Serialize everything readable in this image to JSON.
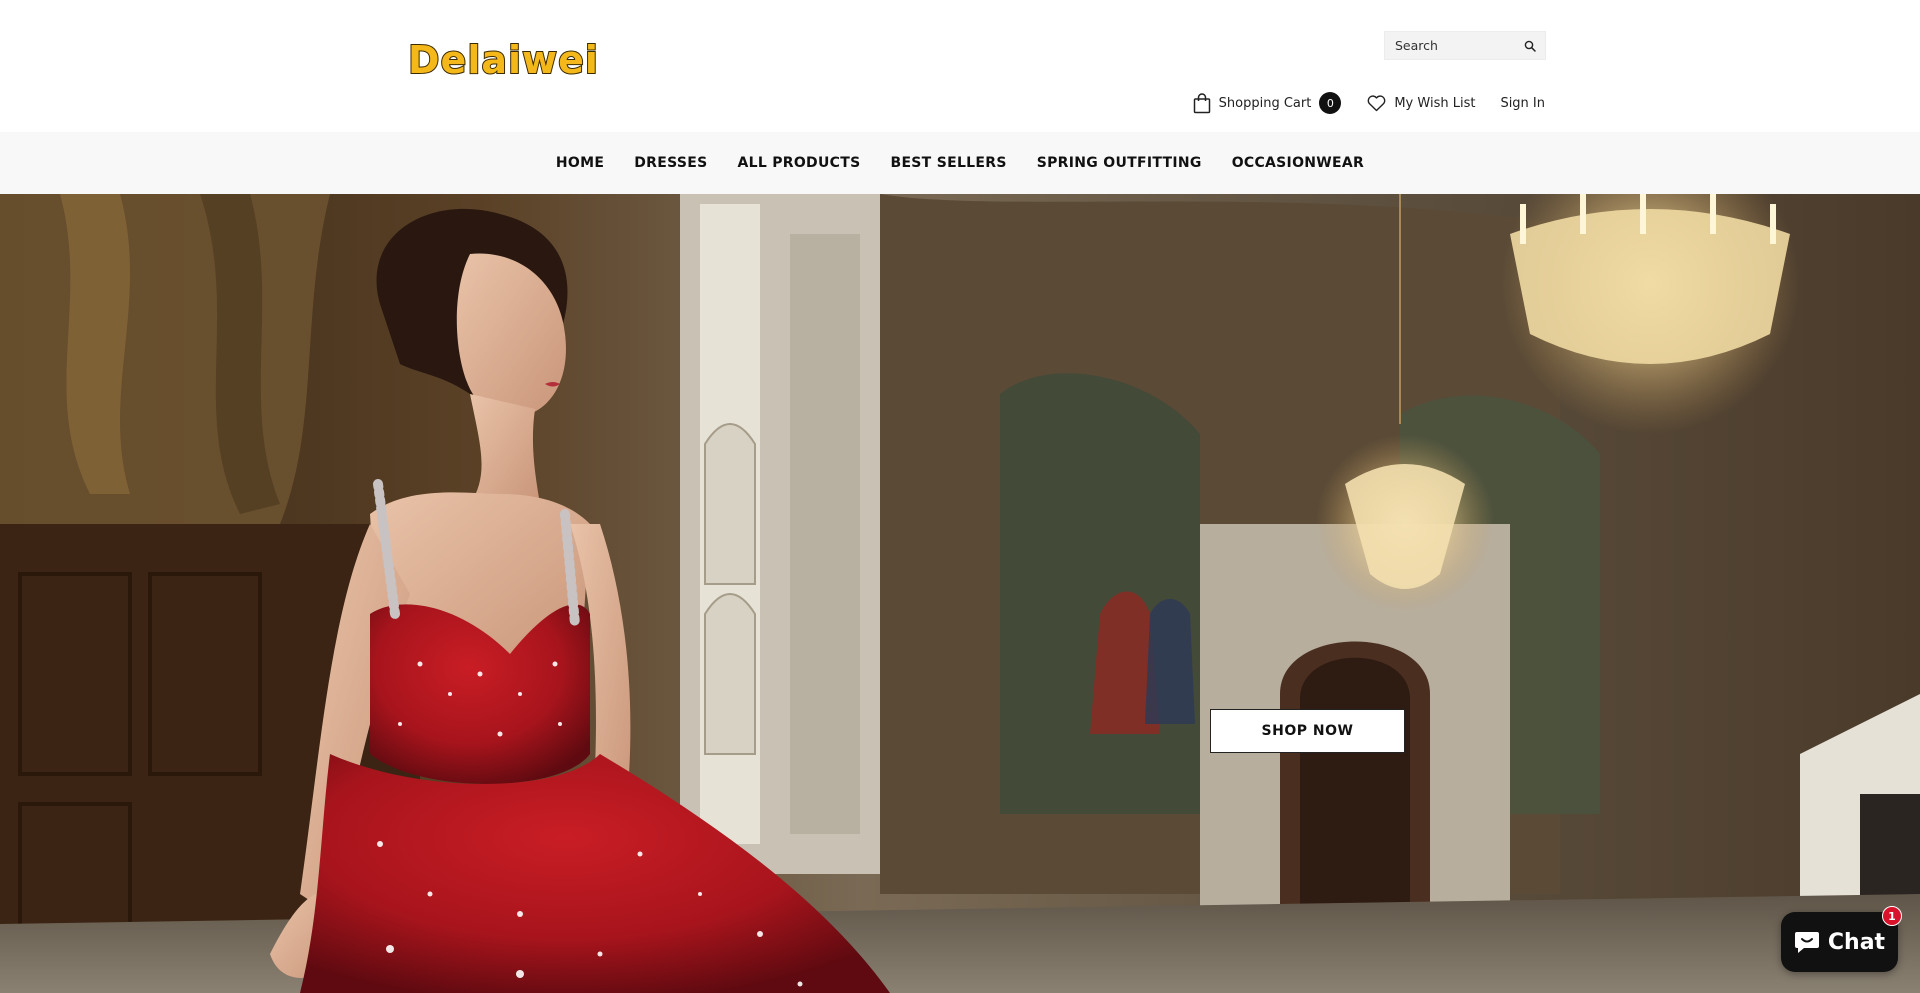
{
  "header": {
    "logo_text": "Delaiwei",
    "search": {
      "placeholder": "Search"
    },
    "links": {
      "cart_label": "Shopping Cart",
      "cart_count": "0",
      "wishlist_label": "My Wish List",
      "signin_label": "Sign In"
    }
  },
  "nav": {
    "items": [
      {
        "label": "HOME"
      },
      {
        "label": "DRESSES"
      },
      {
        "label": "ALL PRODUCTS"
      },
      {
        "label": "BEST SELLERS"
      },
      {
        "label": "SPRING OUTFITTING"
      },
      {
        "label": "OCCASIONWEAR"
      }
    ]
  },
  "hero": {
    "cta_label": "SHOP NOW"
  },
  "chat": {
    "label": "Chat",
    "badge": "1"
  },
  "colors": {
    "logo": "#f5b81a",
    "nav_bg": "#f8f8f8",
    "chat_bg": "#111111",
    "badge": "#d9122b",
    "dress": "#a8141c"
  },
  "icons": {
    "search": "search-icon",
    "cart": "shopping-bag-icon",
    "wishlist": "heart-icon",
    "chat": "chat-bubble-icon"
  }
}
